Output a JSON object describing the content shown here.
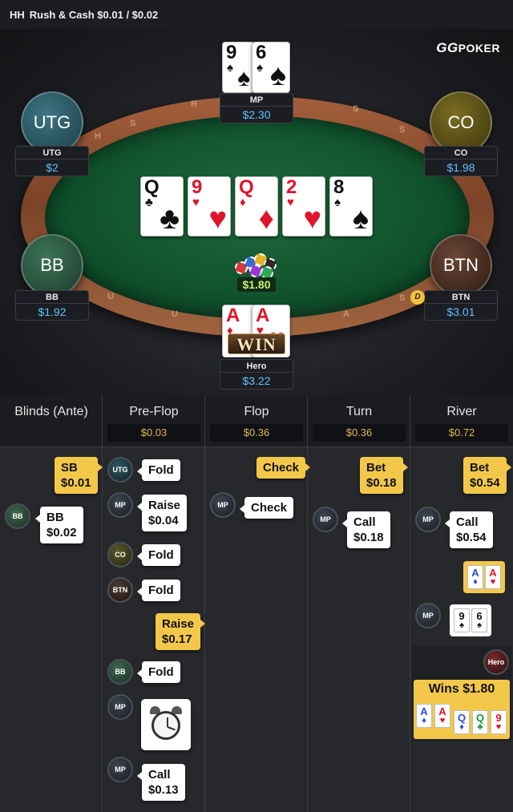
{
  "header": {
    "game_code": "HH",
    "title": "Rush & Cash $0.01 / $0.02"
  },
  "brand": {
    "gg": "GG",
    "poker": "POKER"
  },
  "table": {
    "rail_letters": [
      "S",
      "R",
      "S",
      "H",
      "S",
      "U",
      "U",
      "S",
      "A",
      "€"
    ],
    "board": [
      {
        "rank": "Q",
        "suit": "♣",
        "color": "#111111"
      },
      {
        "rank": "9",
        "suit": "♥",
        "color": "#e0142a"
      },
      {
        "rank": "Q",
        "suit": "♦",
        "color": "#e0142a"
      },
      {
        "rank": "2",
        "suit": "♥",
        "color": "#e0142a"
      },
      {
        "rank": "8",
        "suit": "♠",
        "color": "#111111"
      }
    ],
    "pot": "$1.80",
    "dealer_label": "D",
    "win_label": "WIN",
    "seats": {
      "mp": {
        "name": "MP",
        "stack": "$2.30",
        "cards": [
          {
            "rank": "9",
            "suit": "♠"
          },
          {
            "rank": "6",
            "suit": "♠"
          }
        ]
      },
      "utg": {
        "circle": "UTG",
        "name": "UTG",
        "stack": "$2",
        "color": "#2e5c66"
      },
      "co": {
        "circle": "CO",
        "name": "CO",
        "stack": "$1.98",
        "color": "#5b5420"
      },
      "bb": {
        "circle": "BB",
        "name": "BB",
        "stack": "$1.92",
        "color": "#2e5a44"
      },
      "btn": {
        "circle": "BTN",
        "name": "BTN",
        "stack": "$3.01",
        "color": "#4a3024"
      },
      "hero": {
        "name": "Hero",
        "stack": "$3.22",
        "cards": [
          {
            "rank": "A",
            "suit": "♦"
          },
          {
            "rank": "A",
            "suit": "♥"
          }
        ]
      }
    }
  },
  "history": {
    "columns": [
      {
        "title": "Blinds (Ante)",
        "amount": ""
      },
      {
        "title": "Pre-Flop",
        "amount": "$0.03"
      },
      {
        "title": "Flop",
        "amount": "$0.36"
      },
      {
        "title": "Turn",
        "amount": "$0.36"
      },
      {
        "title": "River",
        "amount": "$0.72"
      }
    ],
    "blinds": {
      "sb": {
        "line1": "SB",
        "line2": "$0.01"
      },
      "bb": {
        "pos": "BB",
        "line1": "BB",
        "line2": "$0.02"
      }
    },
    "preflop": [
      {
        "pos": "UTG",
        "action": "Fold",
        "amount": ""
      },
      {
        "pos": "MP",
        "action": "Raise",
        "amount": "$0.04"
      },
      {
        "pos": "CO",
        "action": "Fold",
        "amount": ""
      },
      {
        "pos": "BTN",
        "action": "Fold",
        "amount": ""
      },
      {
        "pos": "",
        "action": "Raise",
        "amount": "$0.17"
      },
      {
        "pos": "BB",
        "action": "Fold",
        "amount": ""
      },
      {
        "pos": "MP",
        "action": "",
        "amount": ""
      },
      {
        "pos": "MP",
        "action": "Call",
        "amount": "$0.13"
      }
    ],
    "flop": [
      {
        "pos": "",
        "action": "Check"
      },
      {
        "pos": "MP",
        "action": "Check"
      }
    ],
    "turn": [
      {
        "pos": "",
        "action": "Bet",
        "amount": "$0.18"
      },
      {
        "pos": "MP",
        "action": "Call",
        "amount": "$0.18"
      }
    ],
    "river": [
      {
        "pos": "",
        "action": "Bet",
        "amount": "$0.54"
      },
      {
        "pos": "MP",
        "action": "Call",
        "amount": "$0.54"
      }
    ],
    "river_hero_show": [
      {
        "rank": "A",
        "suit": "♦"
      },
      {
        "rank": "A",
        "suit": "♥"
      }
    ],
    "river_mp_show": [
      {
        "rank": "9",
        "suit": "♠"
      },
      {
        "rank": "6",
        "suit": "♠"
      }
    ],
    "result": {
      "pos": "Hero",
      "label": "Wins $1.80",
      "cards": [
        {
          "rank": "A",
          "suit": "♦",
          "color": "#2a4fd6"
        },
        {
          "rank": "A",
          "suit": "♥",
          "color": "#e0142a"
        },
        {
          "rank": "Q",
          "suit": "♦",
          "color": "#2a4fd6"
        },
        {
          "rank": "Q",
          "suit": "♣",
          "color": "#1a9a3a"
        },
        {
          "rank": "9",
          "suit": "♥",
          "color": "#e0142a"
        }
      ]
    }
  }
}
